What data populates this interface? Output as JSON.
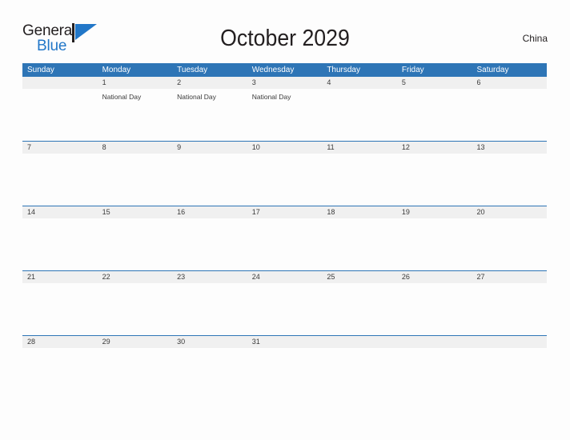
{
  "logo": {
    "word_top": "General",
    "word_bottom": "Blue",
    "flag_color": "#2277c8",
    "pole_color": "#231f20"
  },
  "header": {
    "title": "October 2029",
    "country": "China"
  },
  "colors": {
    "header_blue": "#2e75b6",
    "date_band_gray": "#f0f0f0",
    "page_background": "#fdfdfd",
    "text_dark": "#231f20"
  },
  "calendar": {
    "weekdays": [
      "Sunday",
      "Monday",
      "Tuesday",
      "Wednesday",
      "Thursday",
      "Friday",
      "Saturday"
    ],
    "weeks": [
      {
        "days": [
          {
            "date": "",
            "events": []
          },
          {
            "date": "1",
            "events": [
              "National Day"
            ]
          },
          {
            "date": "2",
            "events": [
              "National Day"
            ]
          },
          {
            "date": "3",
            "events": [
              "National Day"
            ]
          },
          {
            "date": "4",
            "events": []
          },
          {
            "date": "5",
            "events": []
          },
          {
            "date": "6",
            "events": []
          }
        ]
      },
      {
        "days": [
          {
            "date": "7",
            "events": []
          },
          {
            "date": "8",
            "events": []
          },
          {
            "date": "9",
            "events": []
          },
          {
            "date": "10",
            "events": []
          },
          {
            "date": "11",
            "events": []
          },
          {
            "date": "12",
            "events": []
          },
          {
            "date": "13",
            "events": []
          }
        ]
      },
      {
        "days": [
          {
            "date": "14",
            "events": []
          },
          {
            "date": "15",
            "events": []
          },
          {
            "date": "16",
            "events": []
          },
          {
            "date": "17",
            "events": []
          },
          {
            "date": "18",
            "events": []
          },
          {
            "date": "19",
            "events": []
          },
          {
            "date": "20",
            "events": []
          }
        ]
      },
      {
        "days": [
          {
            "date": "21",
            "events": []
          },
          {
            "date": "22",
            "events": []
          },
          {
            "date": "23",
            "events": []
          },
          {
            "date": "24",
            "events": []
          },
          {
            "date": "25",
            "events": []
          },
          {
            "date": "26",
            "events": []
          },
          {
            "date": "27",
            "events": []
          }
        ]
      },
      {
        "days": [
          {
            "date": "28",
            "events": []
          },
          {
            "date": "29",
            "events": []
          },
          {
            "date": "30",
            "events": []
          },
          {
            "date": "31",
            "events": []
          },
          {
            "date": "",
            "events": []
          },
          {
            "date": "",
            "events": []
          },
          {
            "date": "",
            "events": []
          }
        ]
      }
    ]
  }
}
